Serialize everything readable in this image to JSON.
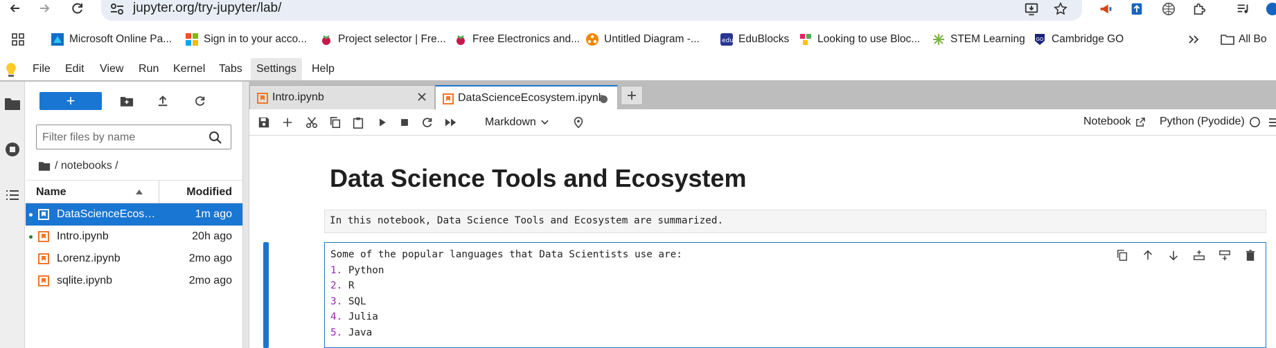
{
  "browser": {
    "url": "jupyter.org/try-jupyter/lab/",
    "bookmarks": [
      {
        "label": "Microsoft Online Pa...",
        "icon": "microsoft-online-icon"
      },
      {
        "label": "Sign in to your acco...",
        "icon": "microsoft-logo-icon"
      },
      {
        "label": "Project selector | Fre...",
        "icon": "raspberry-pi-icon"
      },
      {
        "label": "Free Electronics and...",
        "icon": "raspberry-pi-icon"
      },
      {
        "label": "Untitled Diagram -...",
        "icon": "drawio-icon"
      },
      {
        "label": "EduBlocks",
        "icon": "edublocks-icon"
      },
      {
        "label": "Looking to use Bloc...",
        "icon": "blocks-icon"
      },
      {
        "label": "STEM Learning",
        "icon": "stem-learning-icon"
      },
      {
        "label": "Cambridge GO",
        "icon": "cambridge-go-icon"
      }
    ],
    "all_bookmarks_label": "All Bo"
  },
  "menu": {
    "items": [
      "File",
      "Edit",
      "View",
      "Run",
      "Kernel",
      "Tabs",
      "Settings",
      "Help"
    ],
    "active": "Settings"
  },
  "filebrowser": {
    "new_label": "+",
    "filter_placeholder": "Filter files by name",
    "breadcrumb": "/ notebooks /",
    "col_name": "Name",
    "col_modified": "Modified",
    "files": [
      {
        "name": "DataScienceEcosy...",
        "modified": "1m ago",
        "running": true,
        "selected": true
      },
      {
        "name": "Intro.ipynb",
        "modified": "20h ago",
        "running": true,
        "selected": false
      },
      {
        "name": "Lorenz.ipynb",
        "modified": "2mo ago",
        "running": false,
        "selected": false
      },
      {
        "name": "sqlite.ipynb",
        "modified": "2mo ago",
        "running": false,
        "selected": false
      }
    ]
  },
  "tabs": [
    {
      "label": "Intro.ipynb",
      "active": false
    },
    {
      "label": "DataScienceEcosystem.ipynb",
      "active": true
    }
  ],
  "toolbar": {
    "cell_type": "Markdown",
    "notebook_label": "Notebook",
    "kernel_label": "Python (Pyodide)"
  },
  "notebook": {
    "heading": "Data Science Tools and Ecosystem",
    "raw_text": "In this notebook, Data Science Tools and Ecosystem are summarized.",
    "editing_cell": {
      "intro": "Some of the popular languages that Data Scientists use are:",
      "list": [
        {
          "num": "1.",
          "text": "Python"
        },
        {
          "num": "2.",
          "text": "R"
        },
        {
          "num": "3.",
          "text": "SQL"
        },
        {
          "num": "4.",
          "text": "Julia"
        },
        {
          "num": "5.",
          "text": "Java"
        }
      ]
    }
  },
  "colors": {
    "accent": "#1976d2",
    "list_number": "#9c27b0",
    "notebook_icon": "#f37626"
  }
}
